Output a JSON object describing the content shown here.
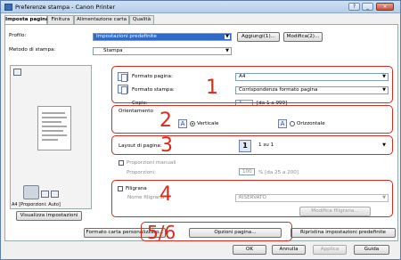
{
  "window": {
    "title": "Preferenze stampa - Canon Printer",
    "buttons": {
      "help": "?",
      "minimize": "_",
      "close": "×"
    }
  },
  "tabs": [
    {
      "label": "Imposta pagina",
      "active": true
    },
    {
      "label": "Finitura"
    },
    {
      "label": "Alimentazione carta"
    },
    {
      "label": "Qualità"
    }
  ],
  "profile": {
    "label": "Profilo:",
    "value": "Impostazioni predefinite",
    "add_button": "Aggiungi(1)...",
    "edit_button": "Modifica(2)..."
  },
  "output_method": {
    "label": "Metodo di stampa:",
    "value": "Stampa"
  },
  "preview_caption": "A4 [Proporzioni: Auto]",
  "view_settings_button": "Visualizza impostazioni",
  "page_size": {
    "label": "Formato pagina:",
    "value": "A4"
  },
  "output_size": {
    "label": "Formato stampa:",
    "value": "Corrispondenza formato pagina"
  },
  "copies": {
    "label": "Copie:",
    "value": "1",
    "range": "[da 1 a 999]"
  },
  "orientation": {
    "label": "Orientamento",
    "portrait": "Verticale",
    "landscape": "Orizzontale",
    "selected": "portrait"
  },
  "page_layout": {
    "label": "Layout di pagina:",
    "icon_text": "1",
    "value": "1 su 1"
  },
  "manual_scaling": {
    "label": "Proporzioni manuali",
    "scale_label": "Proporzioni:",
    "value": "100",
    "range": "% [da 25 a 200]"
  },
  "watermark": {
    "label": "Filigrana",
    "name_label": "Nome filigrana:",
    "name_value": "RISERVATO",
    "edit_button": "Modifica filigrana..."
  },
  "bottom_buttons": {
    "paper_size_options": "Formato carta personalizzato...",
    "page_options": "Opzioni pagina...",
    "restore_defaults": "Ripristina impostazioni predefinite"
  },
  "dialog_buttons": {
    "ok": "OK",
    "cancel": "Annulla",
    "apply": "Applica",
    "help": "Guida"
  },
  "callouts": [
    "1",
    "2",
    "3",
    "4",
    "5/6"
  ],
  "colors": {
    "callout": "#d62a1c",
    "selection": "#3169c6",
    "title_bar": "#b5cde9"
  }
}
